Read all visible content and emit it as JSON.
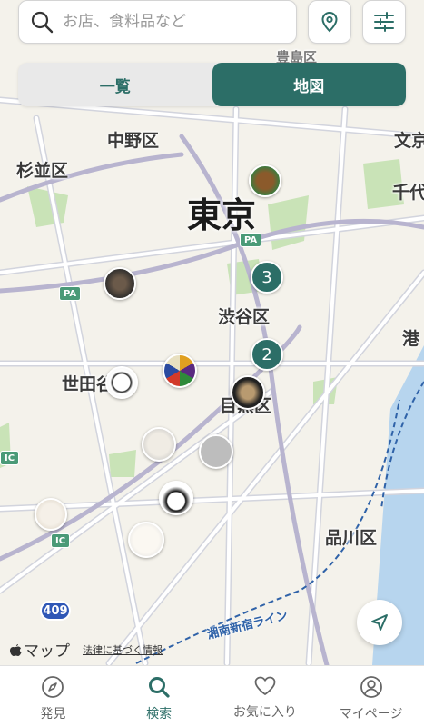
{
  "search": {
    "placeholder": "お店、食料品など"
  },
  "header_buttons": {
    "location": "location-pin-icon",
    "filter": "filter-sliders-icon"
  },
  "view_toggle": {
    "list_label": "一覧",
    "map_label": "地図",
    "selected": "地図"
  },
  "map": {
    "city_label": "東京",
    "wards": {
      "nakano": "中野区",
      "suginami": "杉並区",
      "shibuya": "渋谷区",
      "setagaya": "世田谷",
      "meguro": "目黒区",
      "shinagawa": "品川区",
      "bunkyo": "文京",
      "chiyoda": "千代",
      "minato": "港",
      "toshima": "豊島区"
    },
    "clusters": [
      {
        "count": "3"
      },
      {
        "count": "2"
      }
    ],
    "road_labels": {
      "pa1": "PA",
      "pa2": "PA",
      "ic1": "IC",
      "ic2": "IC",
      "route": "409"
    },
    "rail_label": "湘南新宿ライン",
    "attribution": {
      "brand": "マップ",
      "legal": "法律に基づく情報"
    }
  },
  "colors": {
    "accent": "#2c6e67",
    "route_shield": "#2f57b6",
    "highway": "#4a9a77"
  },
  "tabbar": {
    "items": [
      {
        "label": "発見",
        "icon": "compass-icon"
      },
      {
        "label": "検索",
        "icon": "search-icon",
        "active": true
      },
      {
        "label": "お気に入り",
        "icon": "heart-icon"
      },
      {
        "label": "マイページ",
        "icon": "user-icon"
      }
    ]
  }
}
